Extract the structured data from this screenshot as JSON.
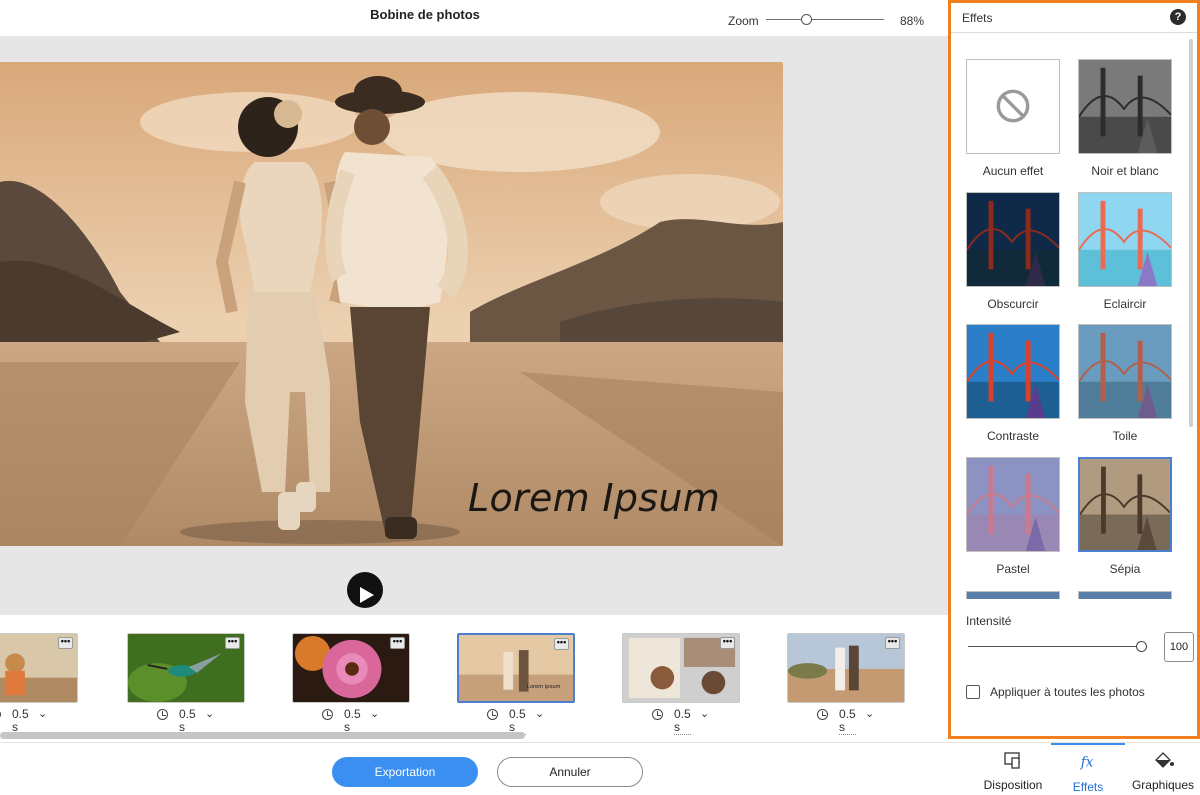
{
  "header": {
    "title": "Bobine de photos",
    "zoom_label": "Zoom",
    "zoom_value": "88%",
    "zoom_level": 0.3
  },
  "preview": {
    "overlay_text": "Lorem Ipsum"
  },
  "filmstrip": {
    "items": [
      {
        "duration": "0.5 s",
        "more": "•••"
      },
      {
        "duration": "0.5 s",
        "more": "•••"
      },
      {
        "duration": "0.5 s",
        "more": "•••"
      },
      {
        "duration": "0.5 s",
        "more": "•••",
        "selected": true
      },
      {
        "duration": "0.5 s",
        "more": "•••"
      },
      {
        "duration": "0.5 s",
        "more": "•••"
      }
    ]
  },
  "footer": {
    "export_label": "Exportation",
    "cancel_label": "Annuler",
    "tabs": [
      {
        "label": "Disposition",
        "icon": "layout-devices-icon"
      },
      {
        "label": "Effets",
        "icon": "fx-icon",
        "active": true
      },
      {
        "label": "Graphiques",
        "icon": "graphics-bucket-icon"
      }
    ]
  },
  "effects_panel": {
    "title": "Effets",
    "help": "?",
    "effects": [
      {
        "label": "Aucun effet",
        "icon": "no-effect-icon"
      },
      {
        "label": "Noir et blanc"
      },
      {
        "label": "Obscurcir"
      },
      {
        "label": "Eclaircir"
      },
      {
        "label": "Contraste"
      },
      {
        "label": "Toile"
      },
      {
        "label": "Pastel"
      },
      {
        "label": "Sépia",
        "selected": true
      }
    ],
    "intensity_label": "Intensité",
    "intensity_value": "100",
    "apply_all_label": "Appliquer à toutes les photos"
  },
  "colors": {
    "accent": "#3b8ff0",
    "panel_border": "#f0801f",
    "selection": "#4a7fd1"
  }
}
